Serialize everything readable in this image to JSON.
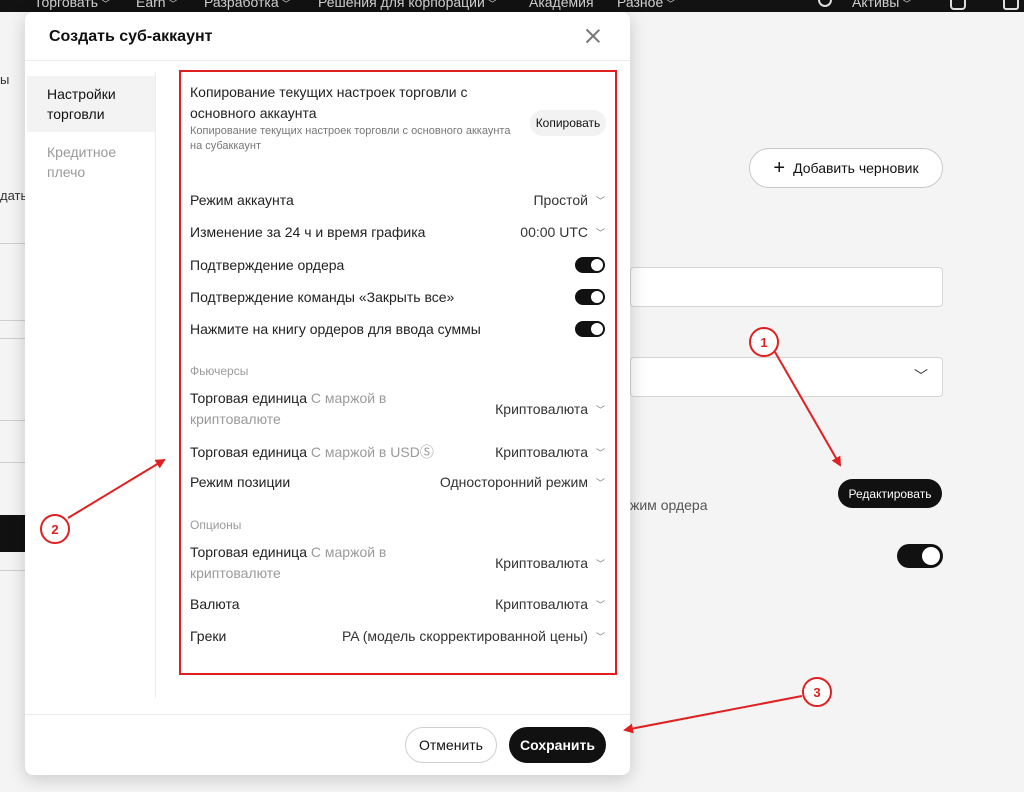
{
  "topnav": {
    "items": [
      "Торговать",
      "Earn",
      "Разработка",
      "Решения для корпорации",
      "Академия",
      "Разное"
    ],
    "assets": "Активы"
  },
  "background": {
    "left_text_1": "ы",
    "left_text_2": "дать",
    "add_draft_label": "Добавить черновик",
    "edit_label": "Редактировать",
    "order_mode_text": "жим ордера"
  },
  "modal": {
    "title": "Создать суб-аккаунт",
    "side_nav": [
      "Настройки торговли",
      "Кредитное плечо"
    ],
    "copy": {
      "title": "Копирование текущих настроек торговли с основного аккаунта",
      "description": "Копирование текущих настроек торговли с основного аккаунта на субаккаунт",
      "button": "Копировать"
    },
    "general": [
      {
        "label": "Режим аккаунта",
        "value": "Простой"
      },
      {
        "label": "Изменение за 24 ч и время графика",
        "value": "00:00 UTC"
      }
    ],
    "toggles": [
      {
        "label": "Подтверждение ордера",
        "on": true
      },
      {
        "label": "Подтверждение команды «Закрыть все»",
        "on": true
      },
      {
        "label": "Нажмите на книгу ордеров для ввода суммы",
        "on": true
      }
    ],
    "futures": {
      "section": "Фьючерсы",
      "unit1_prefix": "Торговая единица",
      "unit1_dim": "С маржой в криптовалюте",
      "unit1_value": "Криптовалюта",
      "unit2_prefix": "Торговая единица",
      "unit2_dim": "С маржой в USDⓈ",
      "unit2_value": "Криптовалюта",
      "position_label": "Режим позиции",
      "position_value": "Односторонний режим"
    },
    "options": {
      "section": "Опционы",
      "unit_prefix": "Торговая единица",
      "unit_dim": "С маржой в криптовалюте",
      "unit_value": "Криптовалюта",
      "currency_label": "Валюта",
      "currency_value": "Криптовалюта",
      "greeks_label": "Греки",
      "greeks_value": "PA (модель скорректированной цены)"
    },
    "cancel": "Отменить",
    "save": "Сохранить"
  },
  "annotations": [
    "1",
    "2",
    "3"
  ],
  "colors": {
    "annotation": "#e02020",
    "primary_button": "#111111"
  }
}
